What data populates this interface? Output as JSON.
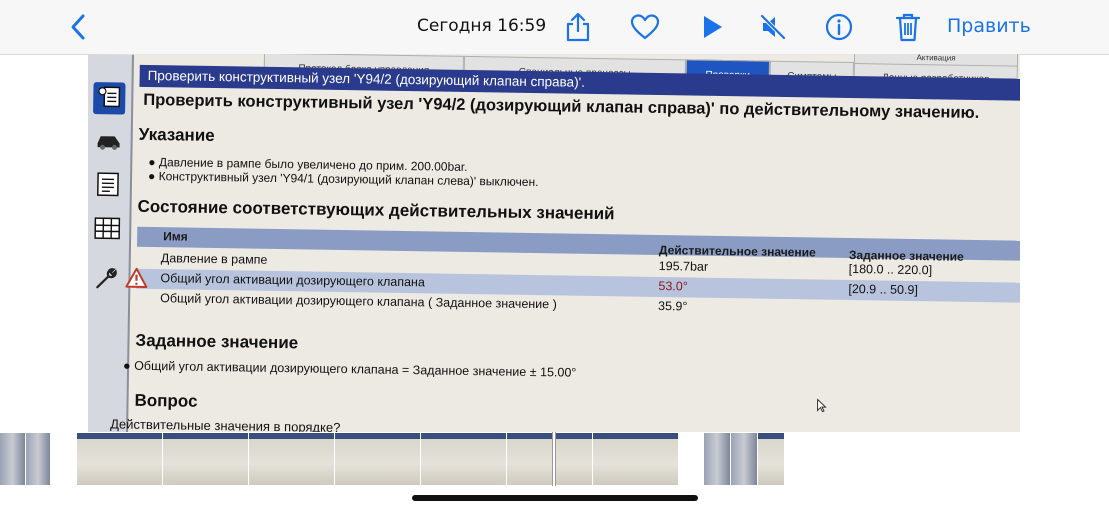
{
  "topbar": {
    "title": "Сегодня  16:59",
    "edit_label": "Править",
    "icons": [
      "back-chevron-icon",
      "share-icon",
      "heart-icon",
      "play-icon",
      "mute-icon",
      "info-icon",
      "trash-icon"
    ],
    "accent": "#1a73e8"
  },
  "app": {
    "tabs": [
      {
        "label": "Протокол блока управления"
      },
      {
        "label": "Специальные процессы"
      },
      {
        "label": "Проверки",
        "active": true
      },
      {
        "label": "Симптомы"
      },
      {
        "label": "Данные разработчиков"
      },
      {
        "label": "Активация"
      }
    ],
    "titlebar": "Проверить конструктивный узел 'Y94/2 (дозирующий клапан справа)'.",
    "heading": "Проверить конструктивный узел 'Y94/2 (дозирующий клапан справа)' по действительному значению.",
    "notice": {
      "title": "Указание",
      "bullets": [
        "Давление в рампе было увеличено до прим. 200.00bar.",
        "Конструктивный узел 'Y94/1 (дозирующий клапан слева)' выключен."
      ]
    },
    "values_section": {
      "title": "Состояние соответствующих действительных значений",
      "headers": {
        "name": "Имя",
        "actual": "Действительное значение",
        "target": "Заданное значение"
      },
      "rows": [
        {
          "name": "Давление в рампе",
          "actual": "195.7bar",
          "target": "[180.0 .. 220.0]"
        },
        {
          "name": "Общий угол активации дозирующего клапана",
          "actual": "53.0°",
          "target": "[20.9 .. 50.9]",
          "warning": true
        },
        {
          "name": "Общий угол активации дозирующего клапана ( Заданное значение )",
          "actual": "35.9°",
          "target": ""
        }
      ]
    },
    "target_section": {
      "title": "Заданное значение",
      "bullet": "Общий угол активации дозирующего клапана = Заданное значение ± 15.00°"
    },
    "question": {
      "title": "Вопрос",
      "text": "Действительные значения в порядке?"
    },
    "colors": {
      "titlebar": "#2a3a8c",
      "active_tab": "#1f55c0",
      "table_header": "#8b9cc4",
      "alt_row": "#b8c4dd",
      "warning": "#c0392b"
    }
  }
}
